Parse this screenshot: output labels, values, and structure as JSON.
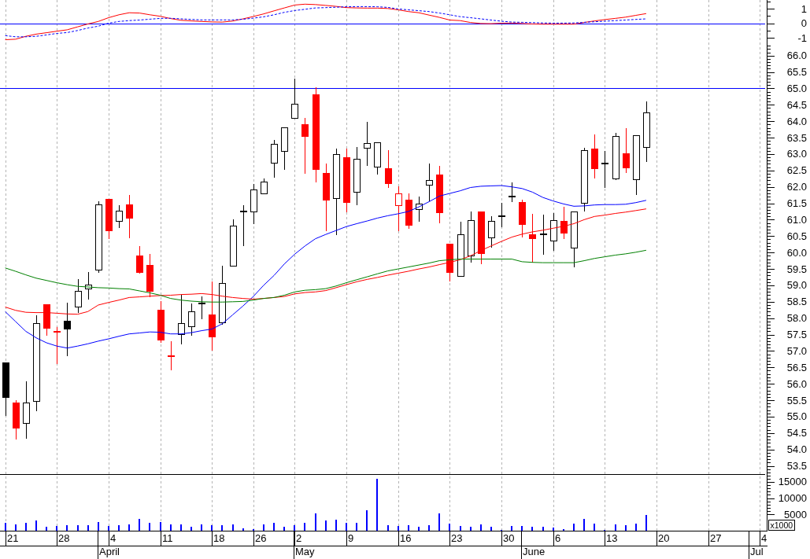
{
  "macd_panel": {
    "chart_data": {
      "type": "line",
      "categories": [
        null,
        null,
        null,
        null,
        null,
        null,
        null,
        null,
        null,
        null,
        null,
        null,
        null,
        null,
        null,
        null,
        null,
        null,
        null,
        null,
        null,
        null,
        null,
        null,
        null,
        null,
        null,
        null,
        null,
        null,
        null,
        null,
        null,
        null,
        null,
        null,
        null,
        null,
        null,
        null,
        null,
        null,
        null,
        null,
        null,
        null,
        null,
        null,
        null,
        null,
        null,
        null,
        null,
        null,
        null,
        null,
        null,
        null,
        null,
        null,
        null,
        null,
        null,
        null,
        null,
        null,
        null,
        null,
        null,
        null,
        null,
        null,
        null,
        null
      ],
      "ylim": [
        -1.32,
        1.595
      ],
      "yticks": [
        {
          "value": 1,
          "label": "1"
        },
        {
          "value": 0,
          "label": "0"
        },
        {
          "value": -1,
          "label": "-1"
        }
      ],
      "series": [
        {
          "color": "#ff0000",
          "values": [
            -1.13,
            -1.1,
            -0.9,
            -0.75,
            -0.65,
            -0.55,
            -0.45,
            -0.25,
            -0.05,
            0.12,
            0.38,
            0.58,
            0.72,
            0.7,
            0.58,
            0.48,
            0.32,
            0.2,
            0.16,
            0.12,
            0.09,
            0.08,
            0.15,
            0.3,
            0.46,
            0.64,
            0.85,
            1.05,
            1.25,
            1.31,
            1.28,
            1.22,
            1.16,
            1.07,
            1.05,
            1.04,
            1.04,
            1.01,
            0.92,
            0.8,
            0.72,
            0.56,
            0.4,
            0.22,
            0.18,
            0.05,
            -0.02,
            -0.03,
            0.0,
            0.01,
            -0.02,
            -0.05,
            -0.06,
            -0.06,
            -0.06,
            -0.06,
            0.05,
            0.16,
            0.25,
            0.33,
            0.42,
            0.54,
            0.66,
            null,
            null,
            null,
            null,
            null,
            null,
            null,
            null,
            null,
            null,
            null
          ]
        },
        {
          "color": "#0000ff",
          "line_style": "dashed",
          "values": [
            -0.85,
            -0.93,
            -0.93,
            -0.9,
            -0.8,
            -0.7,
            -0.64,
            -0.5,
            -0.33,
            -0.2,
            0.0,
            0.12,
            0.18,
            0.22,
            0.28,
            0.33,
            0.34,
            0.3,
            0.26,
            0.23,
            0.23,
            0.23,
            0.23,
            0.27,
            0.35,
            0.44,
            0.58,
            0.75,
            0.87,
            0.96,
            1.05,
            1.07,
            1.1,
            1.13,
            1.14,
            1.14,
            1.13,
            1.09,
            0.98,
            0.92,
            0.86,
            0.8,
            0.7,
            0.58,
            0.45,
            0.38,
            0.3,
            0.22,
            0.14,
            0.08,
            0.06,
            0.04,
            0.02,
            0.01,
            0.01,
            0.02,
            0.06,
            0.1,
            0.14,
            0.18,
            0.22,
            0.26,
            0.3,
            null,
            null,
            null,
            null,
            null,
            null,
            null,
            null,
            null,
            null,
            null
          ]
        }
      ],
      "ref_lines": [
        {
          "axis": "y",
          "value": 0,
          "color": "#0000ff"
        }
      ]
    }
  },
  "price_panel": {
    "chart_data": {
      "type": "candlestick",
      "categories": [
        null,
        null,
        null,
        null,
        null,
        null,
        null,
        null,
        null,
        null,
        null,
        null,
        null,
        null,
        null,
        null,
        null,
        null,
        null,
        null,
        null,
        null,
        null,
        null,
        null,
        null,
        null,
        null,
        null,
        null,
        null,
        null,
        null,
        null,
        null,
        null,
        null,
        null,
        null,
        null,
        null,
        null,
        null,
        null,
        null,
        null,
        null,
        null,
        null,
        null,
        null,
        null,
        null,
        null,
        null,
        null,
        null,
        null,
        null,
        null,
        null,
        null,
        null,
        null,
        null,
        null,
        null,
        null,
        null,
        null,
        null,
        null,
        null,
        null
      ],
      "ylim": [
        53.25,
        66.4
      ],
      "yticks": [
        {
          "value": 66,
          "label": "66.0"
        },
        {
          "value": 65.5,
          "label": "65.5"
        },
        {
          "value": 65,
          "label": "65.0"
        },
        {
          "value": 64.5,
          "label": "64.5"
        },
        {
          "value": 64,
          "label": "64.0"
        },
        {
          "value": 63.5,
          "label": "63.5"
        },
        {
          "value": 63,
          "label": "63.0"
        },
        {
          "value": 62.5,
          "label": "62.5"
        },
        {
          "value": 62,
          "label": "62.0"
        },
        {
          "value": 61.5,
          "label": "61.5"
        },
        {
          "value": 61,
          "label": "61.0"
        },
        {
          "value": 60.5,
          "label": "60.5"
        },
        {
          "value": 60,
          "label": "60.0"
        },
        {
          "value": 59.5,
          "label": "59.5"
        },
        {
          "value": 59,
          "label": "59.0"
        },
        {
          "value": 58.5,
          "label": "58.5"
        },
        {
          "value": 58,
          "label": "58.0"
        },
        {
          "value": 57.5,
          "label": "57.5"
        },
        {
          "value": 57,
          "label": "57.0"
        },
        {
          "value": 56.5,
          "label": "56.5"
        },
        {
          "value": 56,
          "label": "56.0"
        },
        {
          "value": 55.5,
          "label": "55.5"
        },
        {
          "value": 55,
          "label": "55.0"
        },
        {
          "value": 54.5,
          "label": "54.5"
        },
        {
          "value": 54,
          "label": "54.0"
        },
        {
          "value": 53.5,
          "label": "53.5"
        }
      ],
      "series": [
        {
          "color": "#000000",
          "ohlc": [
            [
              56.65,
              56.65,
              55.03,
              55.6
            ],
            null,
            [
              54.8,
              56.07,
              54.32,
              55.42
            ],
            [
              55.48,
              58.09,
              55.17,
              57.84
            ],
            null,
            null,
            [
              57.93,
              58.46,
              56.85,
              57.68
            ],
            [
              58.35,
              59.18,
              58.15,
              58.83
            ],
            [
              58.89,
              59.41,
              58.57,
              59.02
            ],
            [
              59.48,
              61.56,
              59.39,
              61.47
            ],
            null,
            [
              60.97,
              61.44,
              60.74,
              61.27
            ],
            null,
            null,
            null,
            null,
            null,
            [
              57.5,
              58.72,
              57.2,
              57.84
            ],
            [
              57.75,
              58.44,
              57.46,
              58.21
            ],
            [
              58.48,
              58.67,
              57.98,
              58.45
            ],
            null,
            [
              57.87,
              59.59,
              57.8,
              59.07
            ],
            [
              59.59,
              61.02,
              59.58,
              60.81
            ],
            [
              61.28,
              61.44,
              60.19,
              61.26
            ],
            [
              61.27,
              62.08,
              60.86,
              61.93
            ],
            [
              61.82,
              62.26,
              61.78,
              62.17
            ],
            [
              62.75,
              63.42,
              62.29,
              63.32
            ],
            [
              63.09,
              63.81,
              62.51,
              63.81
            ],
            [
              64.11,
              65.29,
              64.11,
              64.54
            ],
            null,
            null,
            null,
            [
              61.66,
              63.17,
              60.54,
              62.99
            ],
            null,
            [
              61.85,
              63.21,
              61.45,
              62.85
            ],
            [
              63.18,
              63.97,
              62.63,
              63.33
            ],
            [
              62.61,
              63.36,
              62.37,
              63.36
            ],
            null,
            null,
            null,
            [
              61.34,
              61.71,
              60.93,
              61.5
            ],
            [
              62.06,
              62.7,
              61.57,
              62.2
            ],
            null,
            null,
            [
              59.3,
              60.95,
              59.3,
              60.56
            ],
            [
              59.92,
              61.25,
              59.69,
              60.99
            ],
            null,
            [
              60.47,
              61.1,
              60.16,
              60.97
            ],
            [
              61.14,
              61.51,
              60.77,
              61.12
            ],
            [
              61.74,
              62.13,
              61.53,
              61.74
            ],
            null,
            null,
            [
              60.57,
              61.16,
              59.94,
              60.56
            ],
            [
              60.37,
              61.21,
              60.06,
              60.99
            ],
            null,
            [
              60.16,
              61.25,
              59.55,
              61.25
            ],
            [
              61.51,
              63.2,
              61.25,
              63.11
            ],
            null,
            [
              62.73,
              63.09,
              61.97,
              62.72
            ],
            [
              62.25,
              63.65,
              62.22,
              63.54
            ],
            null,
            [
              62.22,
              63.57,
              61.76,
              63.57
            ],
            [
              63.21,
              64.61,
              62.77,
              64.27
            ],
            null,
            null,
            null,
            null,
            null,
            null,
            null,
            null,
            null,
            null,
            null
          ]
        },
        {
          "color": "#ff0000",
          "ohlc": [
            null,
            [
              55.42,
              55.49,
              54.3,
              54.66
            ],
            null,
            null,
            [
              58.43,
              58.43,
              57.46,
              57.72
            ],
            [
              57.62,
              57.72,
              56.6,
              57.62
            ],
            null,
            null,
            null,
            null,
            [
              61.64,
              61.64,
              60.42,
              60.68
            ],
            null,
            [
              61.46,
              61.76,
              60.44,
              61.06
            ],
            [
              59.92,
              60.19,
              59.36,
              59.41
            ],
            [
              59.63,
              59.96,
              58.63,
              58.83
            ],
            [
              58.26,
              58.53,
              57.24,
              57.36
            ],
            [
              56.87,
              57.3,
              56.42,
              56.87
            ],
            null,
            null,
            null,
            [
              58.12,
              59.11,
              57.02,
              57.46
            ],
            null,
            null,
            null,
            null,
            null,
            null,
            null,
            null,
            [
              63.9,
              64.09,
              62.41,
              63.54
            ],
            [
              64.83,
              65.03,
              62.14,
              62.56
            ],
            [
              62.43,
              62.72,
              60.65,
              61.62
            ],
            null,
            [
              62.91,
              63.16,
              61.23,
              61.54
            ],
            null,
            null,
            null,
            [
              62.57,
              63.12,
              61.97,
              62.11
            ],
            [
              61.44,
              62.02,
              60.65,
              61.8
            ],
            [
              61.62,
              61.81,
              60.73,
              60.85
            ],
            null,
            null,
            [
              62.38,
              62.65,
              60.88,
              61.22
            ],
            [
              60.28,
              60.28,
              59.13,
              59.41
            ],
            null,
            null,
            [
              61.25,
              61.25,
              59.64,
              59.98
            ],
            null,
            null,
            null,
            [
              61.53,
              61.62,
              60.47,
              60.87
            ],
            [
              60.56,
              61.18,
              59.7,
              60.44
            ],
            null,
            null,
            [
              60.97,
              61.39,
              60.42,
              60.62
            ],
            null,
            null,
            [
              63.17,
              63.6,
              62.26,
              62.56
            ],
            null,
            null,
            [
              63.03,
              63.78,
              62.43,
              62.61
            ],
            null,
            null,
            null,
            null,
            null,
            null,
            null,
            null,
            null,
            null,
            null,
            null,
            null
          ]
        },
        {
          "type": "line",
          "color": "#0000ff",
          "values": [
            58.2,
            57.9,
            57.6,
            57.4,
            57.25,
            57.15,
            57.09,
            57.15,
            57.22,
            57.3,
            57.37,
            57.45,
            57.52,
            57.55,
            57.58,
            57.57,
            57.52,
            57.52,
            57.56,
            57.62,
            57.67,
            57.83,
            58.1,
            58.37,
            58.66,
            59.0,
            59.3,
            59.65,
            59.95,
            60.2,
            60.42,
            60.55,
            60.67,
            60.79,
            60.88,
            60.96,
            61.05,
            61.12,
            61.18,
            61.25,
            61.39,
            61.55,
            61.72,
            61.8,
            61.88,
            61.98,
            62.02,
            62.03,
            62.04,
            62.0,
            61.95,
            61.84,
            61.68,
            61.57,
            61.48,
            61.41,
            61.42,
            61.45,
            61.46,
            61.46,
            61.47,
            61.52,
            61.59,
            null,
            null,
            null,
            null,
            null,
            null,
            null,
            null,
            null,
            null,
            null
          ]
        },
        {
          "type": "line",
          "color": "#ff0000",
          "values": [
            58.34,
            58.24,
            58.18,
            58.17,
            58.17,
            58.15,
            58.13,
            58.12,
            58.2,
            58.4,
            58.48,
            58.55,
            58.63,
            58.65,
            58.67,
            58.69,
            58.7,
            58.72,
            58.73,
            58.75,
            58.72,
            58.67,
            58.63,
            58.6,
            58.58,
            58.6,
            58.63,
            58.66,
            58.74,
            58.78,
            58.8,
            58.84,
            58.93,
            59.02,
            59.11,
            59.18,
            59.24,
            59.31,
            59.37,
            59.43,
            59.5,
            59.56,
            59.63,
            59.7,
            59.78,
            59.9,
            60.06,
            60.2,
            60.34,
            60.47,
            60.56,
            60.63,
            60.68,
            60.74,
            60.8,
            60.88,
            61.0,
            61.1,
            61.14,
            61.19,
            61.23,
            61.28,
            61.33,
            null,
            null,
            null,
            null,
            null,
            null,
            null,
            null,
            null,
            null,
            null
          ]
        },
        {
          "type": "line",
          "color": "#008000",
          "values": [
            59.53,
            59.43,
            59.32,
            59.22,
            59.15,
            59.08,
            59.02,
            58.97,
            58.95,
            58.93,
            58.92,
            58.9,
            58.89,
            58.83,
            58.77,
            58.7,
            58.6,
            58.55,
            58.52,
            58.5,
            58.49,
            58.49,
            58.5,
            58.51,
            58.55,
            58.6,
            58.63,
            58.7,
            58.8,
            58.85,
            58.87,
            58.9,
            58.98,
            59.08,
            59.17,
            59.26,
            59.35,
            59.44,
            59.5,
            59.56,
            59.62,
            59.68,
            59.75,
            59.78,
            59.8,
            59.8,
            59.8,
            59.8,
            59.8,
            59.8,
            59.72,
            59.7,
            59.69,
            59.69,
            59.69,
            59.69,
            59.75,
            59.82,
            59.87,
            59.92,
            59.96,
            60.01,
            60.07,
            null,
            null,
            null,
            null,
            null,
            null,
            null,
            null,
            null,
            null,
            null
          ]
        }
      ],
      "ref_lines": [
        {
          "axis": "y",
          "value": 65,
          "color": "#0000ff"
        }
      ]
    }
  },
  "volume_panel": {
    "unit": "x1000",
    "chart_data": {
      "type": "bar",
      "categories": [
        null,
        null,
        null,
        null,
        null,
        null,
        null,
        null,
        null,
        null,
        null,
        null,
        null,
        null,
        null,
        null,
        null,
        null,
        null,
        null,
        null,
        null,
        null,
        null,
        null,
        null,
        null,
        null,
        null,
        null,
        null,
        null,
        null,
        null,
        null,
        null,
        null,
        null,
        null,
        null,
        null,
        null,
        null,
        null,
        null,
        null,
        null,
        null,
        null,
        null,
        null,
        null,
        null,
        null,
        null,
        null,
        null,
        null,
        null,
        null,
        null,
        null,
        null,
        null,
        null,
        null,
        null,
        null,
        null,
        null,
        null,
        null,
        null,
        null
      ],
      "ylim": [
        0,
        17400
      ],
      "yticks": [
        {
          "value": 15000,
          "label": "15000"
        },
        {
          "value": 10000,
          "label": "10000"
        },
        {
          "value": 5000,
          "label": "5000"
        }
      ],
      "series": [
        {
          "color": "#0000ff",
          "values": [
            2400,
            2000,
            2300,
            3200,
            1300,
            1500,
            1800,
            1800,
            1800,
            2700,
            1500,
            1800,
            2000,
            3700,
            2400,
            2700,
            1900,
            1900,
            1100,
            1900,
            1700,
            1700,
            1900,
            800,
            500,
            1900,
            2300,
            1300,
            1700,
            2300,
            5400,
            3200,
            3400,
            2400,
            2300,
            6300,
            16000,
            1700,
            1500,
            1800,
            1100,
            1700,
            5400,
            2200,
            1500,
            1300,
            1900,
            1100,
            300,
            1500,
            1500,
            1300,
            1300,
            1000,
            500,
            2200,
            3600,
            2200,
            200,
            1900,
            1700,
            2200,
            4800,
            null,
            null,
            null,
            null,
            null,
            null,
            null,
            null,
            null,
            null,
            null
          ]
        }
      ]
    }
  },
  "time_axis": {
    "days": [
      "21",
      "28",
      "4",
      "11",
      "18",
      "26",
      "2",
      "9",
      "16",
      "23",
      "30",
      "6",
      "13",
      "20",
      "27",
      "4"
    ],
    "months": [
      "April",
      "May",
      "June",
      "Jul"
    ]
  }
}
